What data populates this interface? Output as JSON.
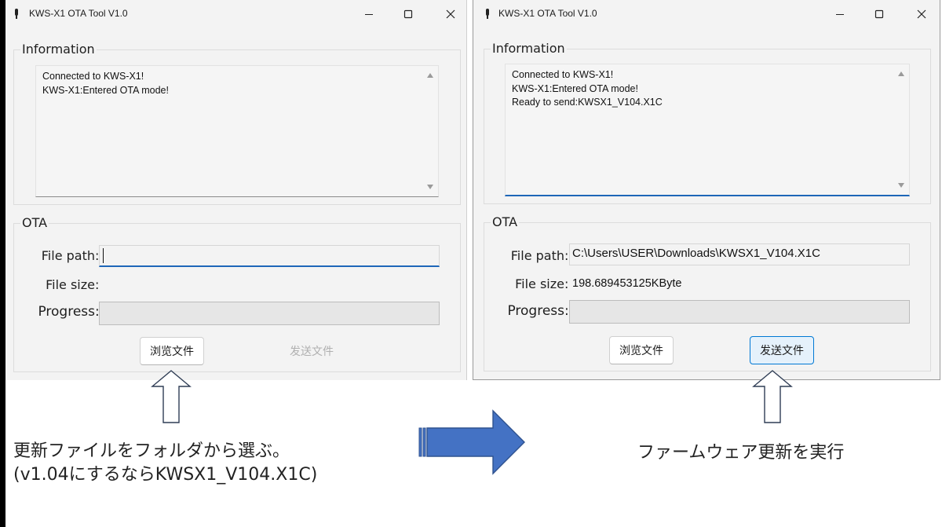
{
  "left_window": {
    "title": "KWS-X1 OTA Tool V1.0",
    "info_group_label": "Information",
    "info_lines": [
      "Connected to KWS-X1!",
      "KWS-X1:Entered OTA mode!"
    ],
    "ota_group_label": "OTA",
    "file_path_label": "File path",
    "file_path_value": "",
    "file_size_label": "File size",
    "file_size_value": "",
    "progress_label": "Progress",
    "progress_fraction": 0,
    "browse_button": "浏览文件",
    "send_button": "发送文件",
    "send_enabled": false
  },
  "right_window": {
    "title": "KWS-X1 OTA Tool V1.0",
    "info_group_label": "Information",
    "info_lines": [
      "Connected to KWS-X1!",
      "KWS-X1:Entered OTA mode!",
      "Ready to send:KWSX1_V104.X1C"
    ],
    "ota_group_label": "OTA",
    "file_path_label": "File path",
    "file_path_value": "C:\\Users\\USER\\Downloads\\KWSX1_V104.X1C",
    "file_size_label": "File size",
    "file_size_value": "198.689453125KByte",
    "progress_label": "Progress",
    "progress_fraction": 0,
    "browse_button": "浏览文件",
    "send_button": "发送文件",
    "send_enabled": true
  },
  "annotations": {
    "left_caption_line1": "更新ファイルをフォルダから選ぶ。",
    "left_caption_line2": "(v1.04にするならKWSX1_V104.X1C)",
    "right_caption": "ファームウェア更新を実行"
  },
  "colors": {
    "window_bg": "#f3f3f3",
    "focus_accent": "#1e66b8",
    "transition_arrow": "#4472c4",
    "transition_arrow_outline": "#2f528f"
  },
  "icons": {
    "app": "app-icon",
    "minimize": "minimize-icon",
    "maximize": "maximize-icon",
    "close": "close-icon",
    "pointer_arrow": "up-arrow-outline-icon",
    "transition_arrow": "right-arrow-block-icon"
  }
}
